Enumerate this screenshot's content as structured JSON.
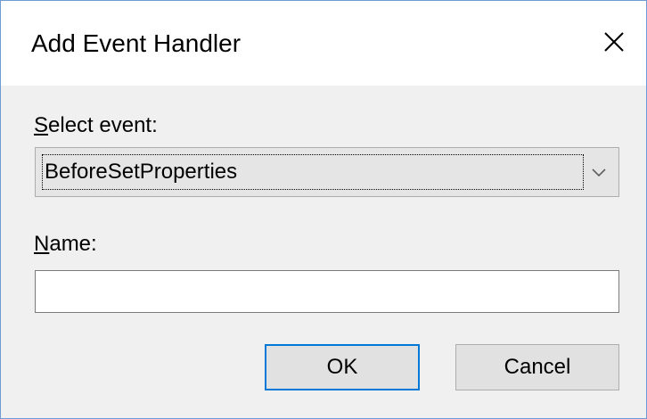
{
  "dialog": {
    "title": "Add Event Handler",
    "close_icon": "close-icon"
  },
  "event_field": {
    "label_accel": "S",
    "label_rest": "elect event:",
    "selected_value": "BeforeSetProperties",
    "dropdown_icon": "chevron-down-icon"
  },
  "name_field": {
    "label_accel": "N",
    "label_rest": "ame:",
    "value": ""
  },
  "buttons": {
    "ok_label": "OK",
    "cancel_label": "Cancel"
  },
  "colors": {
    "window_border": "#6e9bd1",
    "dialog_bg": "#f0f0f0",
    "default_button_border": "#0078d7"
  }
}
